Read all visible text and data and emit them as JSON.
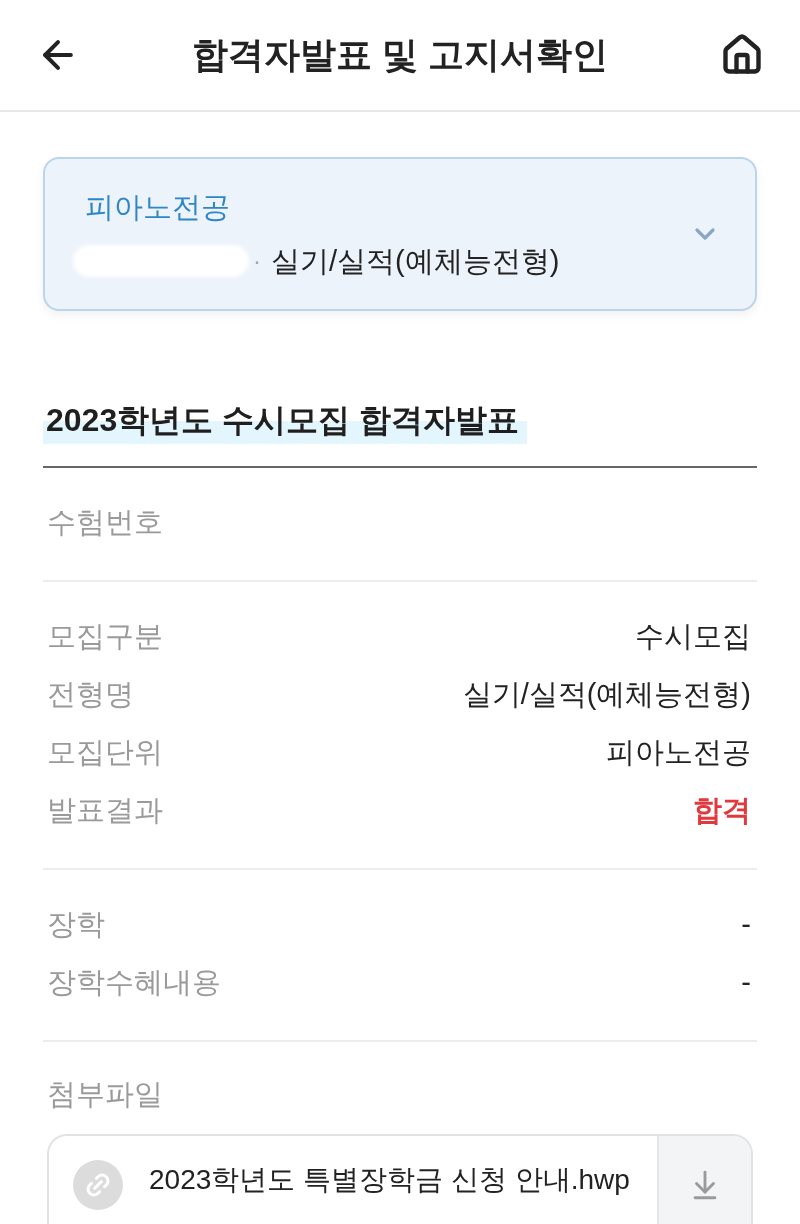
{
  "header": {
    "title": "합격자발표 및 고지서확인"
  },
  "selector": {
    "major": "피아노전공",
    "separator": "·",
    "admission_type": "실기/실적(예체능전형)",
    "expanded": false
  },
  "section": {
    "title": "2023학년도 수시모집 합격자발표"
  },
  "groups": [
    {
      "rows": [
        {
          "kind": "text",
          "label": "수험번호"
        }
      ]
    },
    {
      "rows": [
        {
          "kind": "text",
          "label": "모집구분",
          "value": "수시모집"
        },
        {
          "kind": "text",
          "label": "전형명",
          "value": "실기/실적(예체능전형)"
        },
        {
          "kind": "text",
          "label": "모집단위",
          "value": "피아노전공"
        },
        {
          "kind": "result",
          "label": "발표결과",
          "value": "합격"
        }
      ]
    },
    {
      "rows": [
        {
          "kind": "text",
          "label": "장학",
          "value": "-"
        },
        {
          "kind": "text",
          "label": "장학수혜내용",
          "value": "-"
        }
      ]
    }
  ],
  "attachments": {
    "label": "첨부파일",
    "files": [
      {
        "name": "2023학년도 특별장학금 신청 안내.hwp"
      }
    ]
  }
}
